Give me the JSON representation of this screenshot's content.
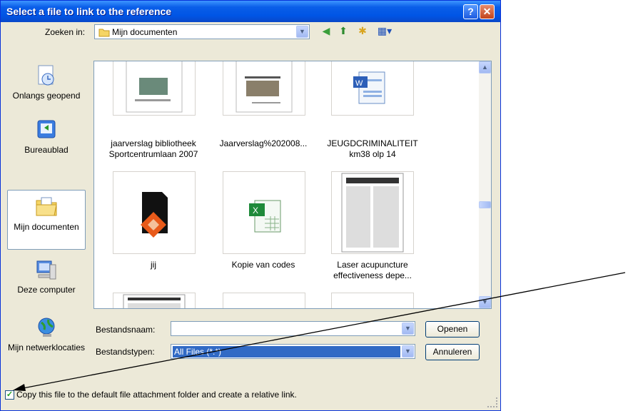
{
  "window": {
    "title": "Select a file to link to the reference",
    "help_glyph": "?",
    "close_glyph": "✕"
  },
  "lookin": {
    "label": "Zoeken in:",
    "value": "Mijn documenten"
  },
  "places": [
    {
      "label": "Onlangs geopend",
      "icon": "recent-icon"
    },
    {
      "label": "Bureaublad",
      "icon": "desktop-icon"
    },
    {
      "label": "Mijn documenten",
      "icon": "my-documents-icon"
    },
    {
      "label": "Deze computer",
      "icon": "computer-icon"
    },
    {
      "label": "Mijn netwerklocaties",
      "icon": "network-icon"
    }
  ],
  "files": [
    {
      "name": "jaarverslag bibliotheek Sportcentrumlaan 2007",
      "kind": "document-thumbnail"
    },
    {
      "name": "Jaarverslag%202008...",
      "kind": "document-thumbnail"
    },
    {
      "name": "JEUGDCRIMINALITEIT km38 olp 14",
      "kind": "word-icon"
    },
    {
      "name": "jij",
      "kind": "image-icon"
    },
    {
      "name": "Kopie van codes",
      "kind": "excel-icon"
    },
    {
      "name": "Laser acupuncture effectiveness depe...",
      "kind": "document-thumbnail"
    }
  ],
  "filename": {
    "label": "Bestandsnaam:",
    "value": ""
  },
  "filetype": {
    "label": "Bestandstypen:",
    "value": "All Files (*.*)"
  },
  "buttons": {
    "open": "Openen",
    "cancel": "Annuleren"
  },
  "checkbox": {
    "label": "Copy this file to the default file attachment folder and create a relative link.",
    "checked": true
  }
}
